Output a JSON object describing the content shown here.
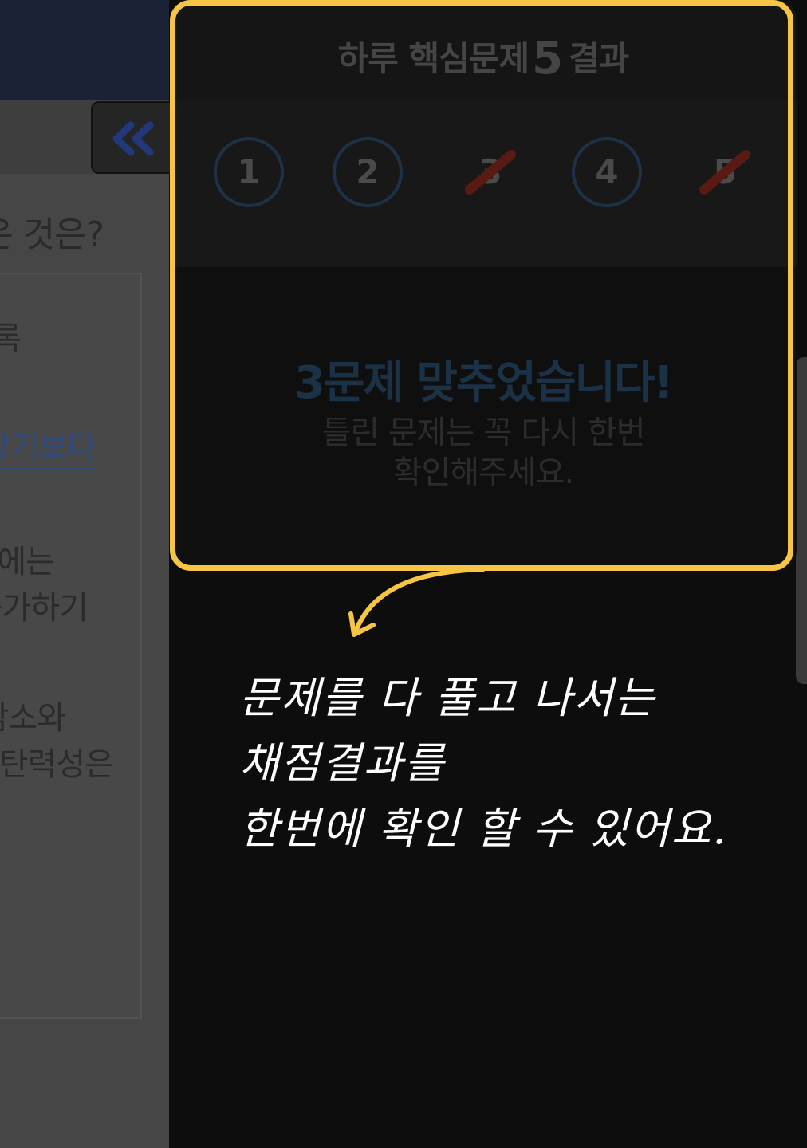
{
  "background_page": {
    "question_fragment": "은 것은?",
    "options": [
      {
        "text": "록",
        "link": false
      },
      {
        "text": "장기보다",
        "link": true
      },
      {
        "text": "에는",
        "link": false
      },
      {
        "text": "증가하기",
        "link": false
      },
      {
        "text": "감소와",
        "link": false
      },
      {
        "text": "탄력성은",
        "link": false
      }
    ]
  },
  "result_panel": {
    "title_prefix": "하루 핵심문제",
    "title_number": "5",
    "title_suffix": "결과",
    "questions": [
      {
        "number": "1",
        "correct": true
      },
      {
        "number": "2",
        "correct": true
      },
      {
        "number": "3",
        "correct": false
      },
      {
        "number": "4",
        "correct": true
      },
      {
        "number": "5",
        "correct": false
      }
    ],
    "message_main": "3문제 맞추었습니다!",
    "message_sub_line1": "틀린 문제는 꼭 다시 한번",
    "message_sub_line2": "확인해주세요."
  },
  "annotation": {
    "line1": "문제를 다 풀고 나서는",
    "line2": "채점결과를",
    "line3": "한번에 확인 할 수 있어요."
  },
  "colors": {
    "highlight": "#f6c544",
    "correct_circle": "#1f3147",
    "wrong_slash": "#5a1a14",
    "message_accent": "#1b3146"
  }
}
